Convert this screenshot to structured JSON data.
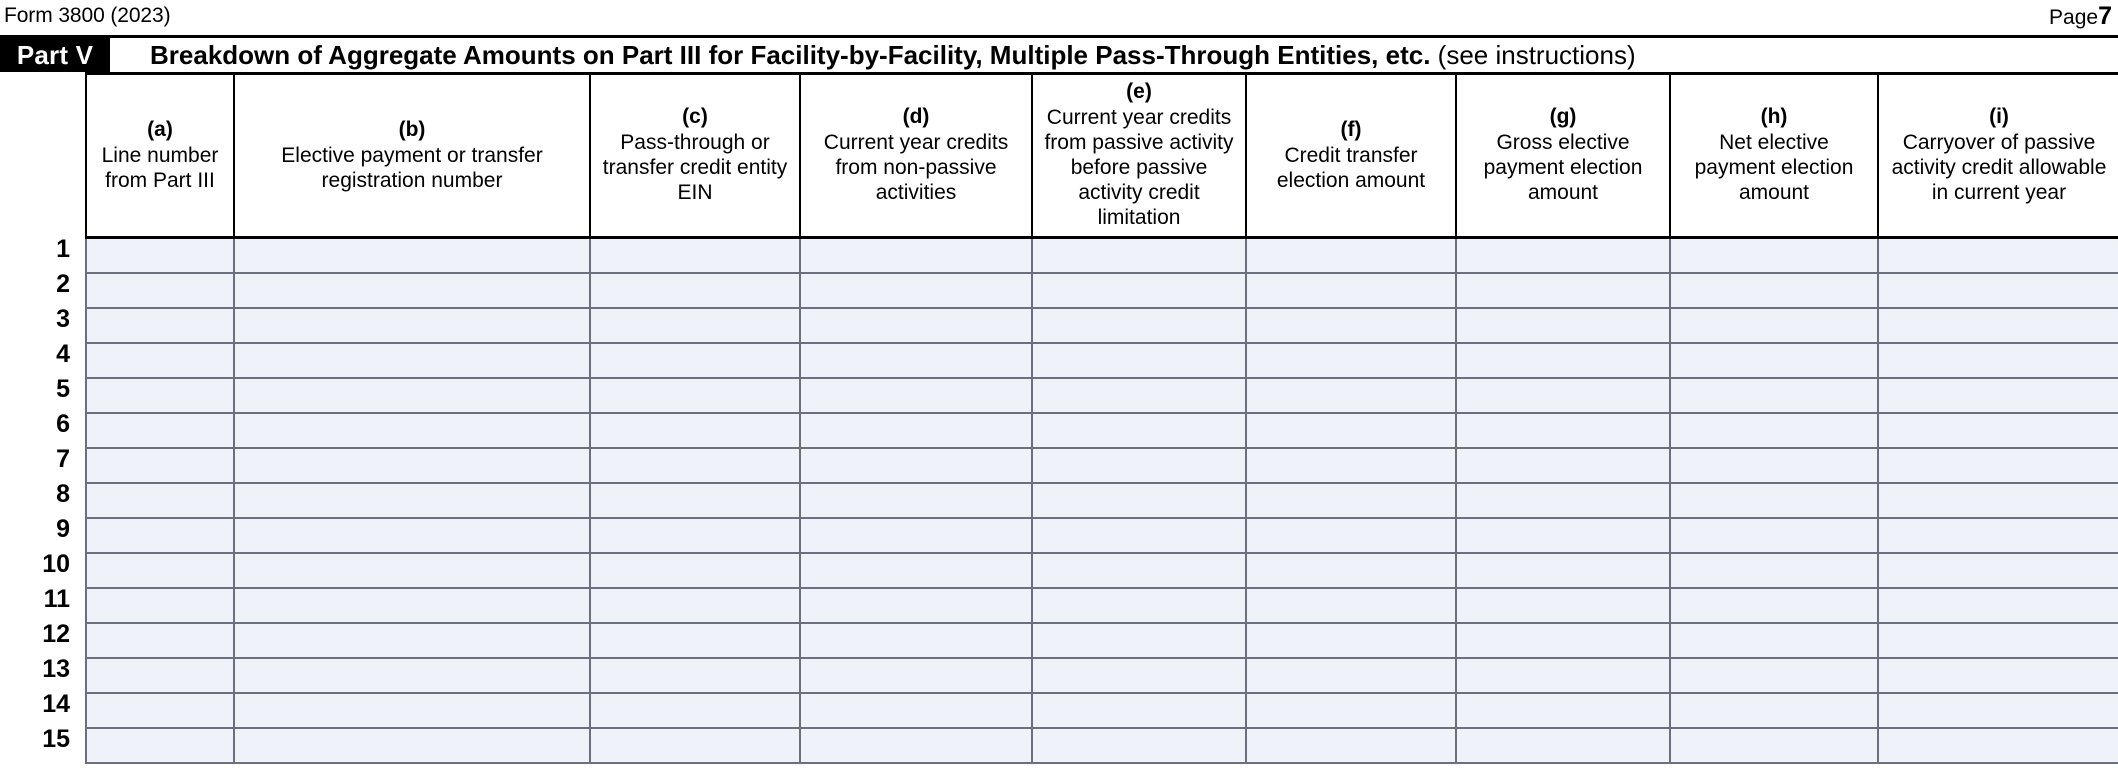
{
  "document": {
    "form_label": "Form 3800 (2023)",
    "page_word": "Page",
    "page_number": "7"
  },
  "part": {
    "tab_label": "Part V",
    "title_strong": "Breakdown of Aggregate Amounts on Part III for Facility-by-Facility, Multiple Pass-Through Entities, etc.",
    "title_light": "(see instructions)"
  },
  "table": {
    "columns": [
      {
        "letter": "(a)",
        "desc": "Line number from Part III"
      },
      {
        "letter": "(b)",
        "desc": "Elective payment or transfer registration number"
      },
      {
        "letter": "(c)",
        "desc": "Pass-through or transfer credit entity EIN"
      },
      {
        "letter": "(d)",
        "desc": "Current year credits from non-passive activities"
      },
      {
        "letter": "(e)",
        "desc": "Current year credits from passive activity before passive activity credit limitation"
      },
      {
        "letter": "(f)",
        "desc": "Credit transfer election amount"
      },
      {
        "letter": "(g)",
        "desc": "Gross elective payment election amount"
      },
      {
        "letter": "(h)",
        "desc": "Net elective payment election amount"
      },
      {
        "letter": "(i)",
        "desc": "Carryover of passive activity credit allowable in current year"
      }
    ],
    "row_numbers": [
      "1",
      "2",
      "3",
      "4",
      "5",
      "6",
      "7",
      "8",
      "9",
      "10",
      "11",
      "12",
      "13",
      "14",
      "15"
    ],
    "rows": [
      {
        "a": "",
        "b": "",
        "c": "",
        "d": "",
        "e": "",
        "f": "",
        "g": "",
        "h": "",
        "i": ""
      },
      {
        "a": "",
        "b": "",
        "c": "",
        "d": "",
        "e": "",
        "f": "",
        "g": "",
        "h": "",
        "i": ""
      },
      {
        "a": "",
        "b": "",
        "c": "",
        "d": "",
        "e": "",
        "f": "",
        "g": "",
        "h": "",
        "i": ""
      },
      {
        "a": "",
        "b": "",
        "c": "",
        "d": "",
        "e": "",
        "f": "",
        "g": "",
        "h": "",
        "i": ""
      },
      {
        "a": "",
        "b": "",
        "c": "",
        "d": "",
        "e": "",
        "f": "",
        "g": "",
        "h": "",
        "i": ""
      },
      {
        "a": "",
        "b": "",
        "c": "",
        "d": "",
        "e": "",
        "f": "",
        "g": "",
        "h": "",
        "i": ""
      },
      {
        "a": "",
        "b": "",
        "c": "",
        "d": "",
        "e": "",
        "f": "",
        "g": "",
        "h": "",
        "i": ""
      },
      {
        "a": "",
        "b": "",
        "c": "",
        "d": "",
        "e": "",
        "f": "",
        "g": "",
        "h": "",
        "i": ""
      },
      {
        "a": "",
        "b": "",
        "c": "",
        "d": "",
        "e": "",
        "f": "",
        "g": "",
        "h": "",
        "i": ""
      },
      {
        "a": "",
        "b": "",
        "c": "",
        "d": "",
        "e": "",
        "f": "",
        "g": "",
        "h": "",
        "i": ""
      },
      {
        "a": "",
        "b": "",
        "c": "",
        "d": "",
        "e": "",
        "f": "",
        "g": "",
        "h": "",
        "i": ""
      },
      {
        "a": "",
        "b": "",
        "c": "",
        "d": "",
        "e": "",
        "f": "",
        "g": "",
        "h": "",
        "i": ""
      },
      {
        "a": "",
        "b": "",
        "c": "",
        "d": "",
        "e": "",
        "f": "",
        "g": "",
        "h": "",
        "i": ""
      },
      {
        "a": "",
        "b": "",
        "c": "",
        "d": "",
        "e": "",
        "f": "",
        "g": "",
        "h": "",
        "i": ""
      },
      {
        "a": "",
        "b": "",
        "c": "",
        "d": "",
        "e": "",
        "f": "",
        "g": "",
        "h": "",
        "i": ""
      }
    ]
  },
  "style": {
    "field_fill": "#f0f2fa",
    "field_border": "#6b7080",
    "rule_color": "#000000",
    "tab_bg": "#000000",
    "tab_fg": "#ffffff"
  }
}
